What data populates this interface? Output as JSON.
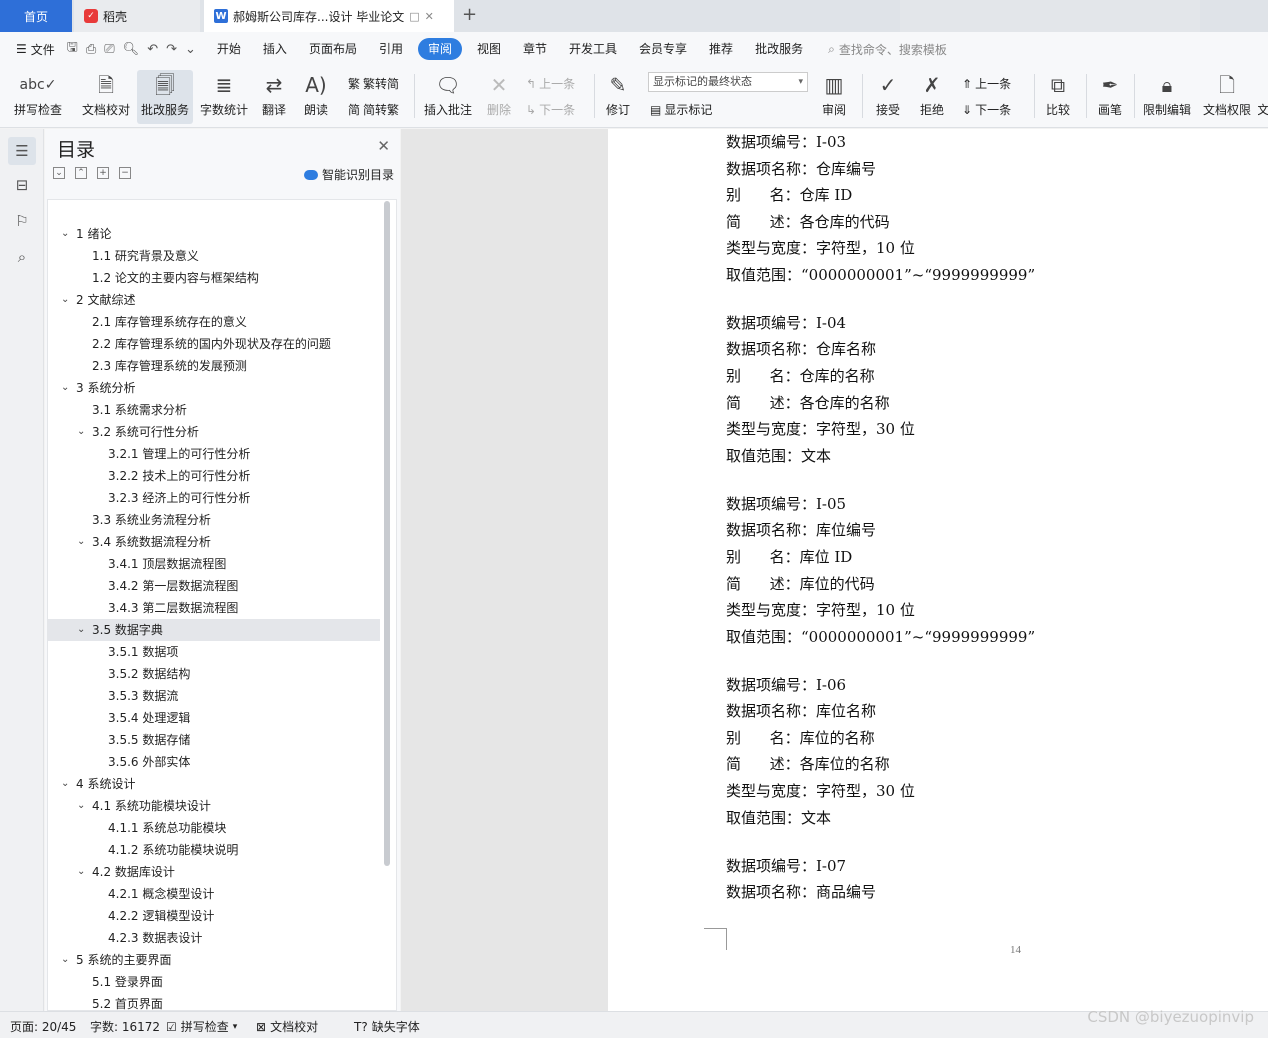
{
  "tabs": {
    "home": "首页",
    "daoke": "稻壳",
    "doc": "郝姆斯公司库存...设计 毕业论文",
    "plus": "+"
  },
  "menu": {
    "file": "文件",
    "items": [
      "开始",
      "插入",
      "页面布局",
      "引用",
      "审阅",
      "视图",
      "章节",
      "开发工具",
      "会员专享",
      "推荐",
      "批改服务"
    ],
    "active": "审阅",
    "search": "查找命令、搜索模板"
  },
  "ribbon": {
    "spellcheck": "拼写检查",
    "doc_proof": "文档校对",
    "correction": "批改服务",
    "word_count": "字数统计",
    "translate": "翻译",
    "read_aloud": "朗读",
    "trad": "繁转简",
    "simp": "简转繁",
    "insert_comment": "插入批注",
    "delete": "删除",
    "prev": "上一条",
    "next": "下一条",
    "revise": "修订",
    "markup_state": "显示标记的最终状态",
    "show_markup": "显示标记",
    "review": "审阅",
    "accept": "接受",
    "reject": "拒绝",
    "prev2": "上一条",
    "next2": "下一条",
    "compare": "比较",
    "pen": "画笔",
    "restrict": "限制编辑",
    "doc_perm": "文档权限",
    "cut": "文"
  },
  "toc": {
    "title": "目录",
    "smart": "智能识别目录",
    "items": [
      {
        "level": 1,
        "text": "1 绪论",
        "chev": true
      },
      {
        "level": 2,
        "text": "1.1 研究背景及意义",
        "chev": false
      },
      {
        "level": 2,
        "text": "1.2 论文的主要内容与框架结构",
        "chev": false
      },
      {
        "level": 1,
        "text": "2 文献综述",
        "chev": true
      },
      {
        "level": 2,
        "text": "2.1 库存管理系统存在的意义",
        "chev": false
      },
      {
        "level": 2,
        "text": "2.2 库存管理系统的国内外现状及存在的问题",
        "chev": false
      },
      {
        "level": 2,
        "text": "2.3 库存管理系统的发展预测",
        "chev": false
      },
      {
        "level": 1,
        "text": "3 系统分析",
        "chev": true
      },
      {
        "level": 2,
        "text": "3.1 系统需求分析",
        "chev": false
      },
      {
        "level": 2,
        "text": "3.2 系统可行性分析",
        "chev": true
      },
      {
        "level": 3,
        "text": "3.2.1 管理上的可行性分析",
        "chev": false
      },
      {
        "level": 3,
        "text": "3.2.2 技术上的可行性分析",
        "chev": false
      },
      {
        "level": 3,
        "text": "3.2.3 经济上的可行性分析",
        "chev": false
      },
      {
        "level": 2,
        "text": "3.3 系统业务流程分析",
        "chev": false
      },
      {
        "level": 2,
        "text": "3.4 系统数据流程分析",
        "chev": true
      },
      {
        "level": 3,
        "text": "3.4.1 顶层数据流程图",
        "chev": false
      },
      {
        "level": 3,
        "text": "3.4.2 第一层数据流程图",
        "chev": false
      },
      {
        "level": 3,
        "text": "3.4.3 第二层数据流程图",
        "chev": false
      },
      {
        "level": 2,
        "text": "3.5 数据字典",
        "chev": true,
        "selected": true
      },
      {
        "level": 3,
        "text": "3.5.1 数据项",
        "chev": false
      },
      {
        "level": 3,
        "text": "3.5.2 数据结构",
        "chev": false
      },
      {
        "level": 3,
        "text": "3.5.3 数据流",
        "chev": false
      },
      {
        "level": 3,
        "text": "3.5.4 处理逻辑",
        "chev": false
      },
      {
        "level": 3,
        "text": "3.5.5 数据存储",
        "chev": false
      },
      {
        "level": 3,
        "text": "3.5.6 外部实体",
        "chev": false
      },
      {
        "level": 1,
        "text": "4 系统设计",
        "chev": true
      },
      {
        "level": 2,
        "text": "4.1 系统功能模块设计",
        "chev": true
      },
      {
        "level": 3,
        "text": "4.1.1 系统总功能模块",
        "chev": false
      },
      {
        "level": 3,
        "text": "4.1.2 系统功能模块说明",
        "chev": false
      },
      {
        "level": 2,
        "text": "4.2 数据库设计",
        "chev": true
      },
      {
        "level": 3,
        "text": "4.2.1 概念模型设计",
        "chev": false
      },
      {
        "level": 3,
        "text": "4.2.2 逻辑模型设计",
        "chev": false
      },
      {
        "level": 3,
        "text": "4.2.3 数据表设计",
        "chev": false
      },
      {
        "level": 1,
        "text": "5 系统的主要界面",
        "chev": true
      },
      {
        "level": 2,
        "text": "5.1 登录界面",
        "chev": false
      },
      {
        "level": 2,
        "text": "5.2 首页界面",
        "chev": false
      }
    ]
  },
  "document": {
    "lines": [
      "数据项编号：I-03",
      "数据项名称：仓库编号",
      "别      名：仓库 ID",
      "简      述：各仓库的代码",
      "类型与宽度：字符型，10 位",
      "取值范围：“0000000001”~“9999999999”",
      "",
      "数据项编号：I-04",
      "数据项名称：仓库名称",
      "别      名：仓库的名称",
      "简      述：各仓库的名称",
      "类型与宽度：字符型，30 位",
      "取值范围：文本",
      "",
      "数据项编号：I-05",
      "数据项名称：库位编号",
      "别      名：库位 ID",
      "简      述：库位的代码",
      "类型与宽度：字符型，10 位",
      "取值范围：“0000000001”~“9999999999”",
      "",
      "数据项编号：I-06",
      "数据项名称：库位名称",
      "别      名：库位的名称",
      "简      述：各库位的名称",
      "类型与宽度：字符型，30 位",
      "取值范围：文本",
      "",
      "数据项编号：I-07",
      "数据项名称：商品编号"
    ],
    "page_number": "14"
  },
  "status": {
    "page": "页面: 20/45",
    "words": "字数: 16172",
    "spell": "拼写检查",
    "proof": "文档校对",
    "font": "缺失字体"
  },
  "watermark": "CSDN @biyezuopinvip"
}
